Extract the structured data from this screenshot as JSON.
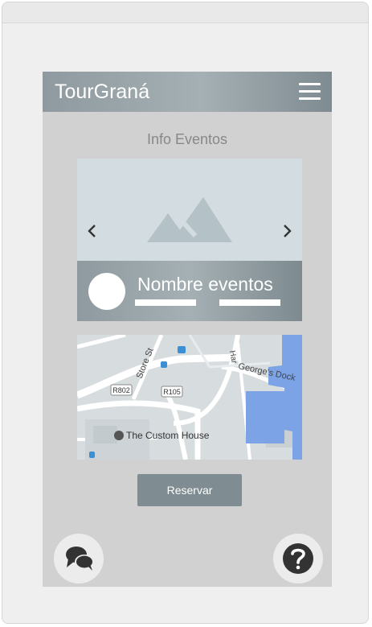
{
  "app": {
    "title": "TourGraná"
  },
  "page": {
    "section_title": "Info Eventos"
  },
  "event_card": {
    "name": "Nombre eventos"
  },
  "map": {
    "labels": {
      "store_st": "Store St",
      "georges_dock": "George's Dock",
      "har": "Har",
      "r802": "R802",
      "r105": "R105",
      "custom_house": "The Custom House"
    }
  },
  "actions": {
    "reserve_label": "Reservar"
  },
  "icons": {
    "menu": "hamburger-menu-icon",
    "image_placeholder": "image-placeholder-icon",
    "prev": "chevron-left-icon",
    "next": "chevron-right-icon",
    "chat": "chat-bubbles-icon",
    "help": "help-circle-icon"
  },
  "colors": {
    "appbar": "#8e9a9f",
    "button": "#7f8c91",
    "screen_bg": "#d1d1d1",
    "map_water": "#7ba3e6"
  }
}
